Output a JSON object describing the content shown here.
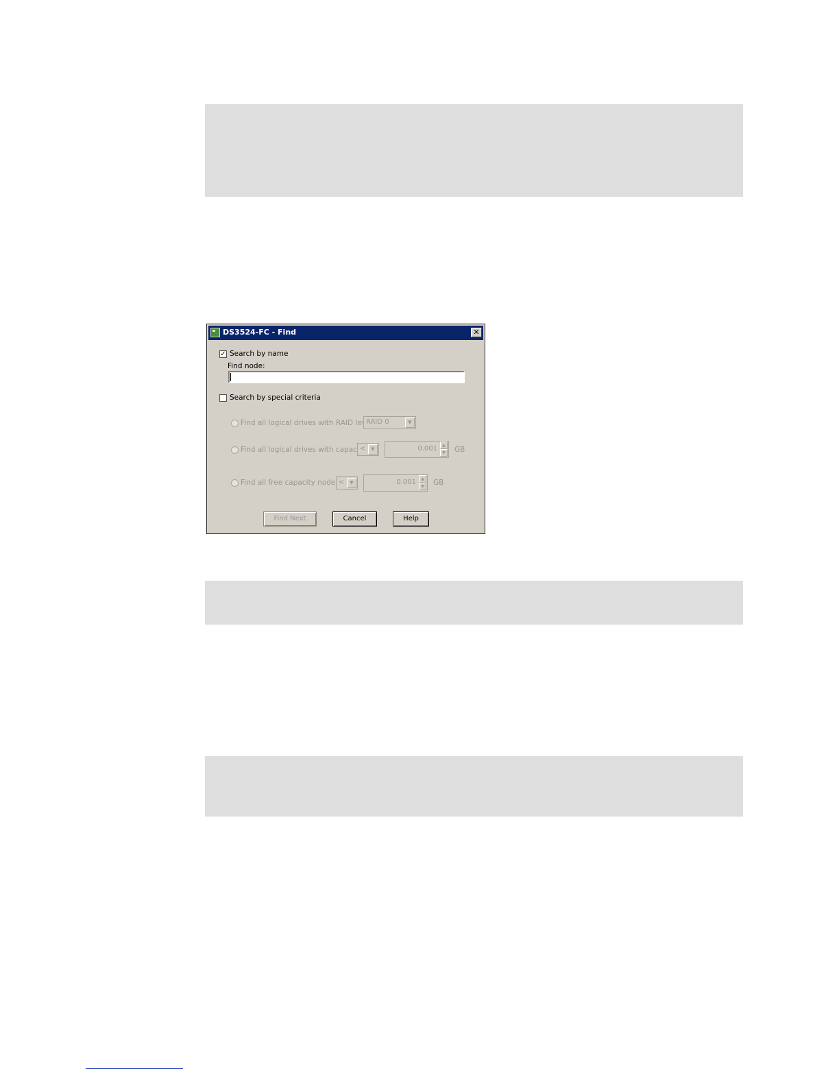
{
  "dialog": {
    "title": "DS3524-FC - Find",
    "close_glyph": "✕",
    "search_by_name": {
      "label": "Search by name",
      "checked": true,
      "check_glyph": "✓"
    },
    "find_node": {
      "label": "Find node:",
      "value": ""
    },
    "search_by_special": {
      "label": "Search by special criteria",
      "checked": false
    },
    "options": {
      "raid": {
        "label": "Find all logical drives with RAID level",
        "select_value": "RAID 0"
      },
      "capacity": {
        "label": "Find all logical drives with capacity",
        "operator": "<",
        "value": "0.001",
        "unit": "GB"
      },
      "free": {
        "label": "Find all free capacity nodes",
        "operator": "<",
        "value": "0.001",
        "unit": "GB"
      }
    },
    "buttons": {
      "find_next": "Find Next",
      "cancel": "Cancel",
      "help": "Help"
    },
    "icons": {
      "app": "storage-app-icon",
      "close": "close-icon",
      "dropdown": "chevron-down-icon",
      "spin_up": "spin-up-icon",
      "spin_down": "spin-down-icon"
    },
    "glyphs": {
      "dropdown": "▼",
      "spin_up": "▲",
      "spin_down": "▼"
    }
  },
  "colors": {
    "titlebar": "#0a246a",
    "dialog_bg": "#d4d0c8",
    "placeholder_block": "#dedede",
    "footer_rule": "#3a54c4"
  }
}
